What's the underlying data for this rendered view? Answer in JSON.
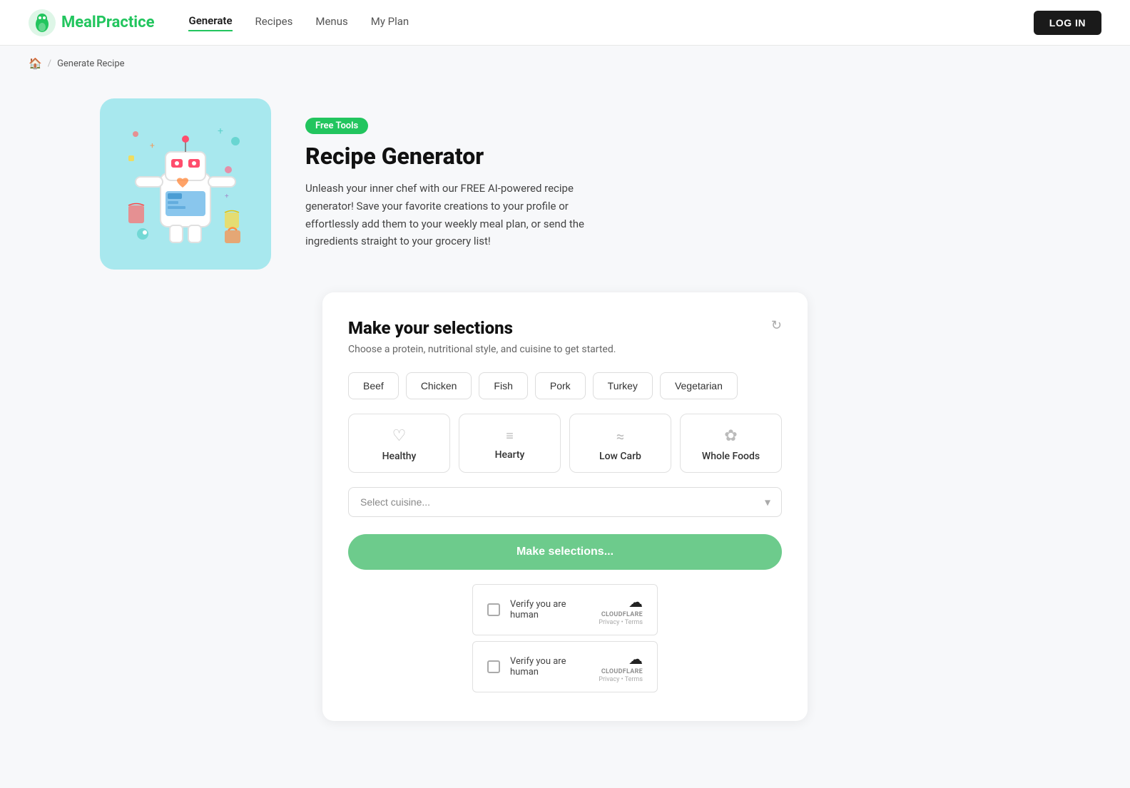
{
  "nav": {
    "logo_text_1": "Meal",
    "logo_text_2": "Practice",
    "links": [
      {
        "label": "Generate",
        "active": true
      },
      {
        "label": "Recipes",
        "active": false
      },
      {
        "label": "Menus",
        "active": false
      },
      {
        "label": "My Plan",
        "active": false
      }
    ],
    "login_label": "LOG IN"
  },
  "breadcrumb": {
    "home_icon": "🏠",
    "separator": "/",
    "current": "Generate Recipe"
  },
  "hero": {
    "badge": "Free Tools",
    "title": "Recipe Generator",
    "description": "Unleash your inner chef with our FREE AI-powered recipe generator! Save your favorite creations to your profile or effortlessly add them to your weekly meal plan, or send the ingredients straight to your grocery list!"
  },
  "selections": {
    "title": "Make your selections",
    "subtitle": "Choose a protein, nutritional style, and cuisine to get started.",
    "proteins": [
      "Beef",
      "Chicken",
      "Fish",
      "Pork",
      "Turkey",
      "Vegetarian"
    ],
    "nutrition_styles": [
      {
        "icon": "♡",
        "label": "Healthy"
      },
      {
        "icon": "≡",
        "label": "Hearty"
      },
      {
        "icon": "~",
        "label": "Low Carb"
      },
      {
        "icon": "✿",
        "label": "Whole Foods"
      }
    ],
    "cuisine_placeholder": "Select cuisine...",
    "submit_label": "Make selections...",
    "cloudflare": [
      {
        "text": "Verify you are human",
        "brand": "CLOUDFLARE",
        "links": "Privacy • Terms"
      },
      {
        "text": "Verify you are human",
        "brand": "CLOUDFLARE",
        "links": "Privacy • Terms"
      }
    ]
  }
}
